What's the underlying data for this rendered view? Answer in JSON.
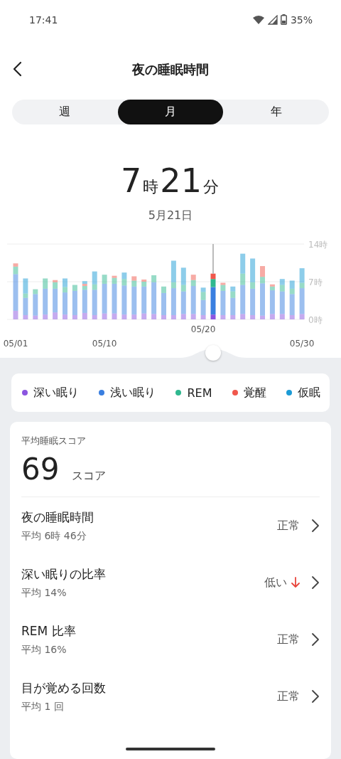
{
  "status_bar": {
    "time": "17:41",
    "battery": "35%"
  },
  "header": {
    "title": "夜の睡眠時間"
  },
  "tabs": [
    {
      "label": "週",
      "selected": false
    },
    {
      "label": "月",
      "selected": true
    },
    {
      "label": "年",
      "selected": false
    }
  ],
  "summary": {
    "duration": [
      {
        "value": "7",
        "unit": "時"
      },
      {
        "value": "21",
        "unit": "分"
      }
    ],
    "date": "5月21日"
  },
  "chart": {
    "chart_data": {
      "type": "bar",
      "stacked": true,
      "categories": [
        "05/01",
        null,
        null,
        null,
        null,
        null,
        null,
        null,
        null,
        "05/10",
        null,
        null,
        null,
        null,
        null,
        null,
        null,
        null,
        null,
        "05/20",
        null,
        null,
        null,
        null,
        null,
        null,
        null,
        null,
        null,
        "05/30"
      ],
      "series": [
        {
          "name": "深い眠り",
          "color": "#8b55e0",
          "values": [
            1.6,
            0.8,
            0.7,
            0.9,
            1.3,
            0.9,
            0.8,
            1.2,
            0.8,
            1.1,
            1.1,
            0.9,
            0.9,
            1.1,
            1.0,
            0.8,
            0.8,
            1.0,
            1.0,
            0.8,
            0.9,
            0.8,
            0.8,
            1.0,
            0.8,
            0.7,
            1.0,
            1.0,
            0.8,
            1.0
          ]
        },
        {
          "name": "浅い眠り",
          "color": "#3a7fe0",
          "values": [
            6.8,
            3.2,
            4.0,
            4.8,
            4.4,
            4.1,
            4.5,
            4.3,
            4.7,
            5.5,
            5.5,
            5.4,
            5.2,
            5.0,
            5.9,
            4.1,
            5.0,
            4.2,
            5.2,
            2.8,
            5.1,
            4.5,
            3.2,
            5.4,
            4.9,
            6.0,
            4.4,
            4.2,
            3.9,
            4.8
          ]
        },
        {
          "name": "REM",
          "color": "#2fb88f",
          "values": [
            1.4,
            0.8,
            0.9,
            1.9,
            1.2,
            1.0,
            1.1,
            0.7,
            1.0,
            1.7,
            1.1,
            1.2,
            1.1,
            0.9,
            1.3,
            1.2,
            1.1,
            1.2,
            1.1,
            1.5,
            1.5,
            1.1,
            1.2,
            2.1,
            1.2,
            1.2,
            0.7,
            1.2,
            1.0,
            1.0
          ]
        },
        {
          "name": "覚醒",
          "color": "#f0574c",
          "values": [
            0.6,
            null,
            null,
            null,
            0.4,
            null,
            null,
            0.4,
            null,
            null,
            0.4,
            null,
            0.8,
            0.4,
            null,
            null,
            null,
            null,
            1.0,
            null,
            1.0,
            0.4,
            null,
            null,
            null,
            2.0,
            0.4,
            null,
            null,
            null
          ]
        },
        {
          "name": "仮眠",
          "color": "#1c9bd6",
          "values": [
            null,
            2.8,
            null,
            null,
            null,
            1.6,
            null,
            0.5,
            2.4,
            null,
            null,
            1.2,
            null,
            null,
            null,
            null,
            4.0,
            3.2,
            null,
            0.8,
            null,
            null,
            0.9,
            3.7,
            4.4,
            null,
            null,
            1.1,
            1.5,
            2.7
          ]
        }
      ],
      "ylim": [
        0,
        14
      ],
      "yticks": [
        {
          "value": 0,
          "label": "0時"
        },
        {
          "value": 7,
          "label": "7時"
        },
        {
          "value": 14,
          "label": "14時"
        }
      ]
    },
    "days": [
      {
        "selected": false
      },
      {
        "selected": false
      },
      {
        "selected": false
      },
      {
        "selected": false
      },
      {
        "selected": false
      },
      {
        "selected": false
      },
      {
        "selected": false
      },
      {
        "selected": false
      },
      {
        "selected": false
      },
      {
        "selected": false
      },
      {
        "selected": false
      },
      {
        "selected": false
      },
      {
        "selected": false
      },
      {
        "selected": false
      },
      {
        "selected": false
      },
      {
        "selected": false
      },
      {
        "selected": false
      },
      {
        "selected": false
      },
      {
        "selected": false
      },
      {
        "selected": false
      },
      {
        "selected": true
      },
      {
        "selected": false
      },
      {
        "selected": false
      },
      {
        "selected": false
      },
      {
        "selected": false
      },
      {
        "selected": false
      },
      {
        "selected": false
      },
      {
        "selected": false
      },
      {
        "selected": false
      },
      {
        "selected": false
      }
    ]
  },
  "score_card": {
    "label": "平均睡眠スコア",
    "score": "69",
    "unit": "スコア",
    "rows": [
      {
        "title": "夜の睡眠時間",
        "average": "平均 6時 46分",
        "status": "正常",
        "falling": false
      },
      {
        "title": "深い眠りの比率",
        "average": "平均 14%",
        "status": "低い",
        "falling": true
      },
      {
        "title": "REM 比率",
        "average": "平均 16%",
        "status": "正常",
        "falling": false
      },
      {
        "title": "目が覚める回数",
        "average": "平均 1 回",
        "status": "正常",
        "falling": false
      }
    ]
  }
}
